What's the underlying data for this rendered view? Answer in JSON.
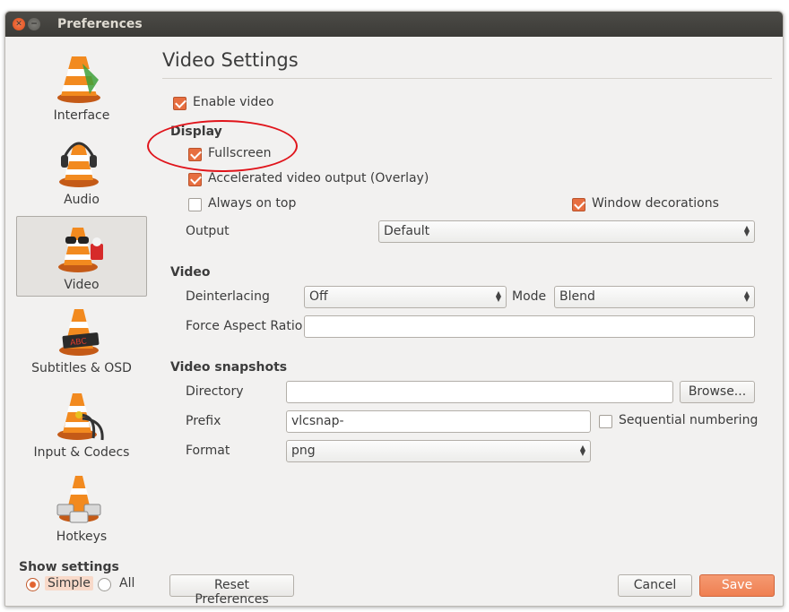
{
  "window": {
    "title": "Preferences"
  },
  "sidebar": {
    "items": [
      {
        "label": "Interface",
        "icon": "vlc-cone-interface-icon"
      },
      {
        "label": "Audio",
        "icon": "vlc-cone-headphones-icon"
      },
      {
        "label": "Video",
        "icon": "vlc-cone-glasses-icon",
        "selected": true
      },
      {
        "label": "Subtitles & OSD",
        "icon": "vlc-cone-subtitles-icon"
      },
      {
        "label": "Input & Codecs",
        "icon": "vlc-cone-cables-icon"
      },
      {
        "label": "Hotkeys",
        "icon": "vlc-cone-keyboard-icon"
      }
    ],
    "show_settings": {
      "title": "Show settings",
      "options": [
        "Simple",
        "All"
      ],
      "selected": "Simple"
    }
  },
  "main": {
    "title": "Video Settings",
    "enable_video": {
      "label": "Enable video",
      "checked": true
    },
    "display": {
      "heading": "Display",
      "fullscreen": {
        "label": "Fullscreen",
        "checked": true
      },
      "overlay": {
        "label": "Accelerated video output (Overlay)",
        "checked": true
      },
      "always_on_top": {
        "label": "Always on top",
        "checked": false
      },
      "window_decorations": {
        "label": "Window decorations",
        "checked": true
      },
      "output": {
        "label": "Output",
        "value": "Default"
      }
    },
    "video": {
      "heading": "Video",
      "deinterlacing": {
        "label": "Deinterlacing",
        "value": "Off"
      },
      "mode": {
        "label": "Mode",
        "value": "Blend"
      },
      "force_aspect_ratio": {
        "label": "Force Aspect Ratio",
        "value": ""
      }
    },
    "snapshots": {
      "heading": "Video snapshots",
      "directory": {
        "label": "Directory",
        "value": ""
      },
      "browse": "Browse...",
      "prefix": {
        "label": "Prefix",
        "value": "vlcsnap-"
      },
      "sequential": {
        "label": "Sequential numbering",
        "checked": false
      },
      "format": {
        "label": "Format",
        "value": "png"
      }
    }
  },
  "footer": {
    "reset": "Reset Preferences",
    "cancel": "Cancel",
    "save": "Save"
  },
  "colors": {
    "accent": "#e76e40",
    "titlebar": "#3c3b37",
    "annotation": "#e0141b"
  }
}
